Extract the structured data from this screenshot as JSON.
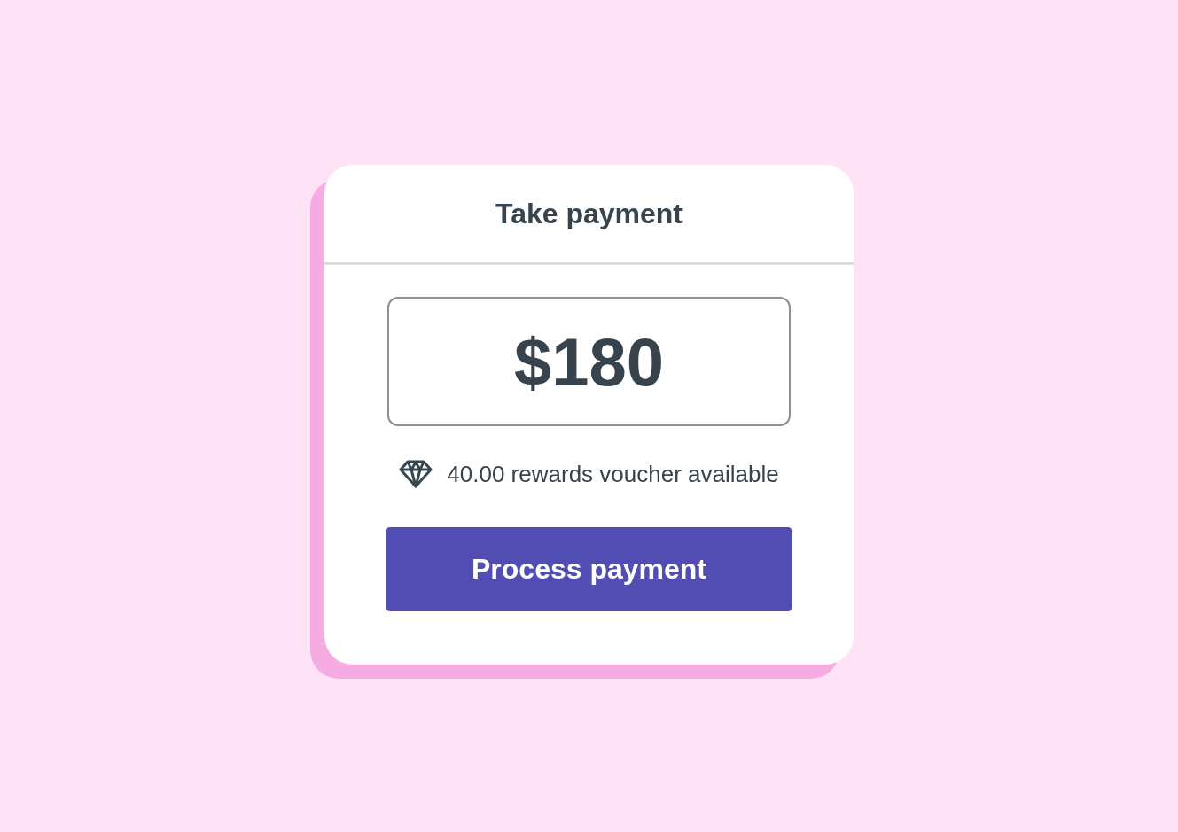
{
  "card": {
    "title": "Take payment"
  },
  "amount": {
    "value": "$180"
  },
  "rewards": {
    "text": "40.00 rewards voucher available"
  },
  "button": {
    "label": "Process payment"
  }
}
